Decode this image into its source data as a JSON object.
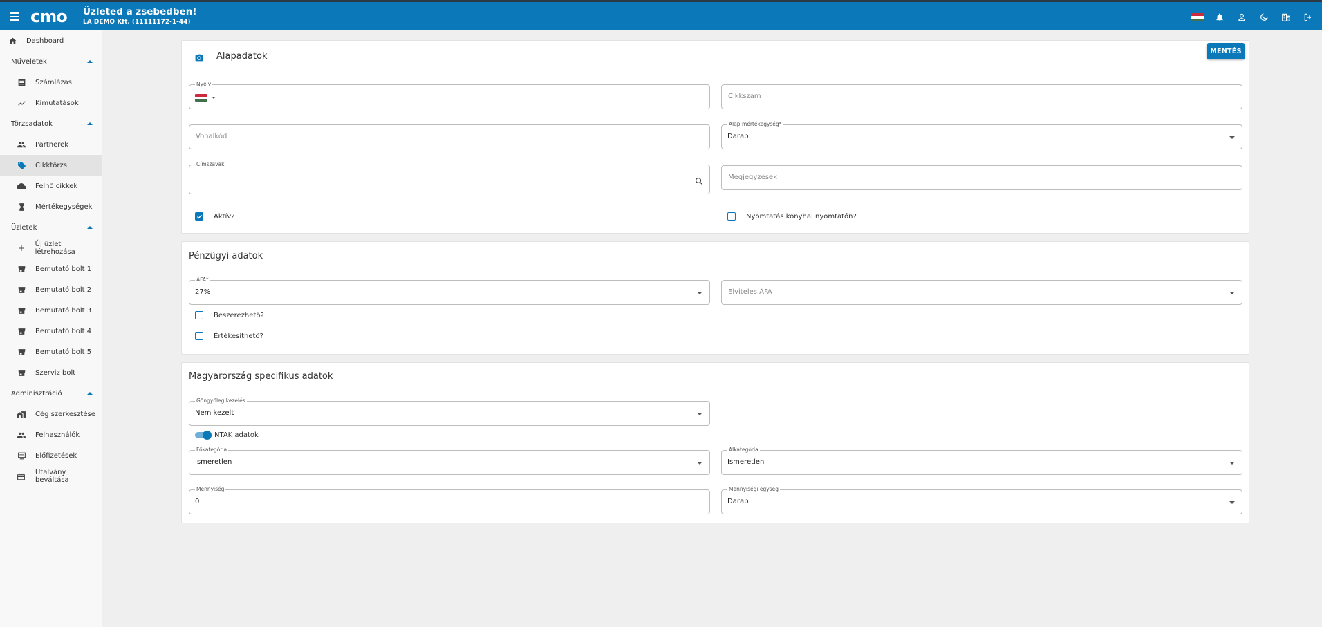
{
  "header": {
    "title": "Üzleted a zsebedben!",
    "company": "LA DEMO Kft. (11111172-1-44)",
    "logo_text": "cmo"
  },
  "colors": {
    "primary": "#0a78b9",
    "background": "#efefef"
  },
  "sidebar": {
    "dashboard": "Dashboard",
    "sections": [
      {
        "title": "Műveletek",
        "items": [
          "Számlázás",
          "Kimutatások"
        ]
      },
      {
        "title": "Törzsadatok",
        "items": [
          "Partnerek",
          "Cikktörzs",
          "Felhő cikkek",
          "Mértékegységek"
        ]
      },
      {
        "title": "Üzletek",
        "items": [
          "Új üzlet létrehozása",
          "Bemutató bolt 1",
          "Bemutató bolt 2",
          "Bemutató bolt 3",
          "Bemutató bolt 4",
          "Bemutató bolt 5",
          "Szerviz bolt"
        ]
      },
      {
        "title": "Adminisztráció",
        "items": [
          "Cég szerkesztése",
          "Felhasználók",
          "Előfizetések",
          "Utalvány beváltása"
        ]
      }
    ],
    "active_item": "Cikktörzs"
  },
  "basic": {
    "title": "Alapadatok",
    "save_label": "MENTÉS",
    "language_label": "Nyelv",
    "sku_placeholder": "Cikkszám",
    "barcode_placeholder": "Vonalkód",
    "unit_label": "Alap mértékegység*",
    "unit_value": "Darab",
    "keywords_label": "Címszavak",
    "notes_placeholder": "Megjegyzések",
    "active_label": "Aktív?",
    "active_checked": true,
    "kitchen_print_label": "Nyomtatás konyhai nyomtatón?",
    "kitchen_print_checked": false
  },
  "finance": {
    "title": "Pénzügyi adatok",
    "vat_label": "ÁFA*",
    "vat_value": "27%",
    "takeaway_vat_placeholder": "Elviteles ÁFA",
    "purchasable_label": "Beszerezhető?",
    "sellable_label": "Értékesíthető?"
  },
  "hungary": {
    "title": "Magyarország specifikus adatok",
    "bottle_label": "Göngyöleg kezelés",
    "bottle_value": "Nem kezelt",
    "ntak_label": "NTAK adatok",
    "ntak_on": true,
    "main_category_label": "Főkategória",
    "main_category_value": "Ismeretlen",
    "sub_category_label": "Alkategória",
    "sub_category_value": "Ismeretlen",
    "quantity_label": "Mennyiség",
    "quantity_value": "0",
    "quantity_unit_label": "Mennyiségi egység",
    "quantity_unit_value": "Darab"
  }
}
